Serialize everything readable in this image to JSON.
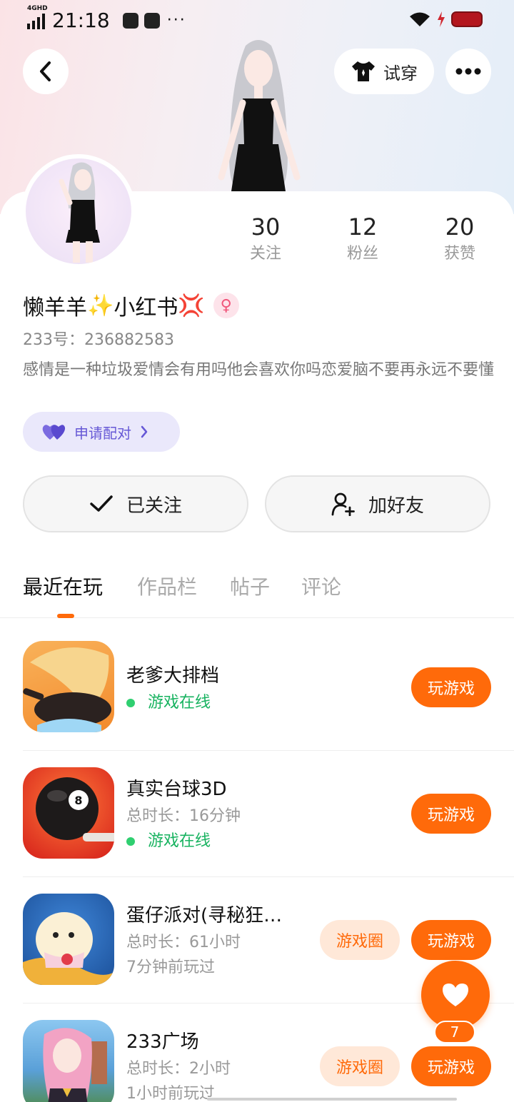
{
  "status_bar": {
    "network": "4GHD",
    "time": "21:18",
    "more": "···"
  },
  "header": {
    "try_on_label": "试穿"
  },
  "profile": {
    "stats": [
      {
        "num": "30",
        "label": "关注"
      },
      {
        "num": "12",
        "label": "粉丝"
      },
      {
        "num": "20",
        "label": "获赞"
      }
    ],
    "nickname_part1": "懒羊羊",
    "sparkle": "✨",
    "nickname_part2": "小红书",
    "anger": "💢",
    "gender_symbol": "♀",
    "uid": "233号：236882583",
    "bio": "感情是一种垃圾爱情会有用吗他会喜欢你吗恋爱脑不要再永远不要懂",
    "pair_label": "申请配对"
  },
  "actions": {
    "followed_label": "已关注",
    "add_friend_label": "加好友"
  },
  "tabs": [
    "最近在玩",
    "作品栏",
    "帖子",
    "评论"
  ],
  "games": [
    {
      "name": "老爹大排档",
      "online": "游戏在线",
      "play": "玩游戏"
    },
    {
      "name": "真实台球3D",
      "duration": "总时长：16分钟",
      "online": "游戏在线",
      "play": "玩游戏"
    },
    {
      "name": "蛋仔派对(寻秘狂…",
      "duration": "总时长：61小时",
      "last_played": "7分钟前玩过",
      "circle": "游戏圈",
      "play": "玩游戏"
    },
    {
      "name": "233广场",
      "duration": "总时长：2小时",
      "last_played": "1小时前玩过",
      "circle": "游戏圈",
      "play": "玩游戏"
    }
  ],
  "fab": {
    "count": "7"
  },
  "colors": {
    "accent": "#ff6a0a",
    "online": "#18b360",
    "pair_text": "#6658d6"
  }
}
